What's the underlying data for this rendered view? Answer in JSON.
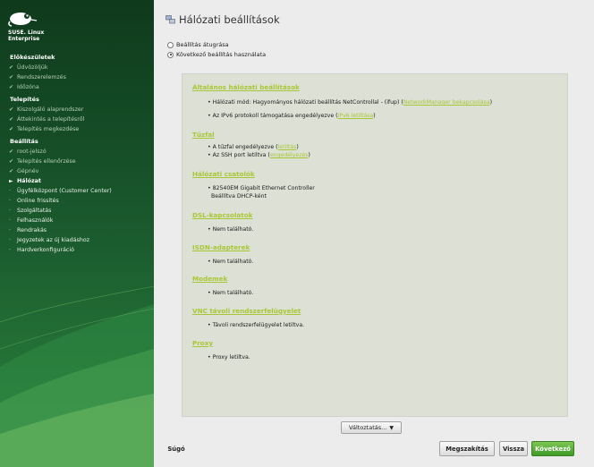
{
  "brand": {
    "line1": "SUSE. Linux",
    "line2": "Enterprise"
  },
  "sidebar": {
    "sections": [
      {
        "label": "Előkészületek",
        "items": [
          {
            "label": "Üdvözöljük",
            "state": "done"
          },
          {
            "label": "Rendszerelemzés",
            "state": "done"
          },
          {
            "label": "Időzóna",
            "state": "done"
          }
        ]
      },
      {
        "label": "Telepítés",
        "items": [
          {
            "label": "Kiszolgáló alaprendszer",
            "state": "done"
          },
          {
            "label": "Áttekintés a telepítésről",
            "state": "done"
          },
          {
            "label": "Telepítés megkezdése",
            "state": "done"
          }
        ]
      },
      {
        "label": "Beállítás",
        "items": [
          {
            "label": "root-jelszó",
            "state": "done"
          },
          {
            "label": "Telepítés ellenőrzése",
            "state": "done"
          },
          {
            "label": "Gépnév",
            "state": "done"
          },
          {
            "label": "Hálózat",
            "state": "current"
          },
          {
            "label": "Ügyfélközpont (Customer Center)",
            "state": "pending"
          },
          {
            "label": "Online frissítés",
            "state": "pending"
          },
          {
            "label": "Szolgáltatás",
            "state": "pending"
          },
          {
            "label": "Felhasználók",
            "state": "pending"
          },
          {
            "label": "Rendrakás",
            "state": "pending"
          },
          {
            "label": "Jegyzetek az új kiadáshoz",
            "state": "pending"
          },
          {
            "label": "Hardverkonfiguráció",
            "state": "pending"
          }
        ]
      }
    ]
  },
  "header": {
    "title": "Hálózati beállítások",
    "icon": "network-settings-icon"
  },
  "options": {
    "skip": "Beállítás átugrása",
    "use": "Következő beállítás használata",
    "selected": "use"
  },
  "sections": {
    "general": {
      "title": "Általános hálózati beállítások",
      "line1_text": "Hálózati mód: Hagyományos hálózati beállítás NetControllal - (ifup) (",
      "line1_link": "NetworkManager bekapcsolása",
      "line1_end": ")",
      "line2_text": "Az IPv6 protokoll támogatása engedélyezve (",
      "line2_link": "IPv6 letiltása",
      "line2_end": ")"
    },
    "firewall": {
      "title": "Tűzfal",
      "line1_text": "A tűzfal engedélyezve (",
      "line1_link": "letiltás",
      "line1_end": ")",
      "line2_text": "Az SSH port letiltva (",
      "line2_link": "engedélyezés",
      "line2_end": ")"
    },
    "interfaces": {
      "title": "Hálózati csatolók",
      "line1": "82540EM Gigabit Ethernet Controller",
      "line2": "Beállítva DHCP-ként"
    },
    "dsl": {
      "title": "DSL-kapcsolatok",
      "line1": "Nem található."
    },
    "isdn": {
      "title": "ISDN-adapterek",
      "line1": "Nem található."
    },
    "modems": {
      "title": "Modemek",
      "line1": "Nem található."
    },
    "vnc": {
      "title": "VNC távoli rendszerfelügyelet",
      "line1": "Távoli rendszerfelügyelet letiltva."
    },
    "proxy": {
      "title": "Proxy",
      "line1": "Proxy letiltva."
    }
  },
  "buttons": {
    "changes": "Változtatás...",
    "help": "Súgó",
    "abort": "Megszakítás",
    "back": "Vissza",
    "next": "Következő"
  },
  "colors": {
    "accent": "#a8c734",
    "sidebar_dark": "#0f3a1c",
    "next_button": "#4fa632"
  }
}
